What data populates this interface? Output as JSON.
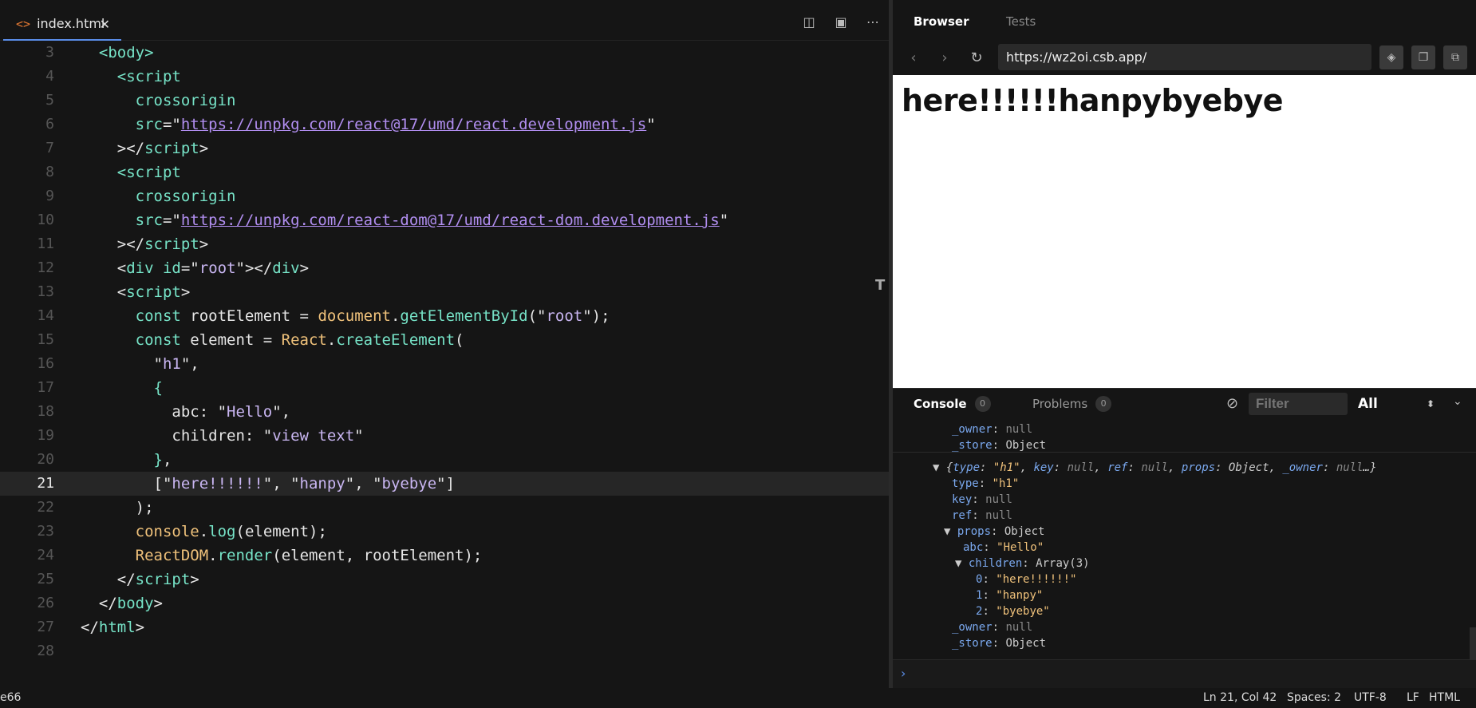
{
  "editor": {
    "tab_label": "index.html",
    "tab_close": "✕",
    "lines": [
      {
        "n": "3",
        "segs": [
          [
            "t-tag",
            "  <body>"
          ]
        ]
      },
      {
        "n": "4",
        "segs": [
          [
            "t-tag",
            "    <script"
          ]
        ]
      },
      {
        "n": "5",
        "segs": [
          [
            "t-attr",
            "      crossorigin"
          ]
        ]
      },
      {
        "n": "6",
        "segs": [
          [
            "t-attr",
            "      src"
          ],
          [
            "t-plain",
            "=\""
          ],
          [
            "t-link",
            "https://unpkg.com/react@17/umd/react.development.js"
          ],
          [
            "t-plain",
            "\""
          ]
        ]
      },
      {
        "n": "7",
        "segs": [
          [
            "t-plain",
            "    ></"
          ],
          [
            "t-tag",
            "script"
          ],
          [
            "t-plain",
            ">"
          ]
        ]
      },
      {
        "n": "8",
        "segs": [
          [
            "t-tag",
            "    <script"
          ]
        ]
      },
      {
        "n": "9",
        "segs": [
          [
            "t-attr",
            "      crossorigin"
          ]
        ]
      },
      {
        "n": "10",
        "segs": [
          [
            "t-attr",
            "      src"
          ],
          [
            "t-plain",
            "=\""
          ],
          [
            "t-link",
            "https://unpkg.com/react-dom@17/umd/react-dom.development.js"
          ],
          [
            "t-plain",
            "\""
          ]
        ]
      },
      {
        "n": "11",
        "segs": [
          [
            "t-plain",
            "    ></"
          ],
          [
            "t-tag",
            "script"
          ],
          [
            "t-plain",
            ">"
          ]
        ]
      },
      {
        "n": "12",
        "segs": [
          [
            "t-plain",
            "    <"
          ],
          [
            "t-tag",
            "div"
          ],
          [
            "t-attr",
            " id"
          ],
          [
            "t-plain",
            "=\""
          ],
          [
            "t-str",
            "root"
          ],
          [
            "t-plain",
            "\"></"
          ],
          [
            "t-tag",
            "div"
          ],
          [
            "t-plain",
            ">"
          ]
        ]
      },
      {
        "n": "13",
        "segs": [
          [
            "t-plain",
            "    <"
          ],
          [
            "t-tag",
            "script"
          ],
          [
            "t-plain",
            ">"
          ]
        ]
      },
      {
        "n": "14",
        "segs": [
          [
            "t-kw",
            "      const "
          ],
          [
            "t-plain",
            "rootElement = "
          ],
          [
            "t-obj",
            "document"
          ],
          [
            "t-plain",
            "."
          ],
          [
            "t-fn",
            "getElementById"
          ],
          [
            "t-plain",
            "(\""
          ],
          [
            "t-str",
            "root"
          ],
          [
            "t-plain",
            "\");"
          ]
        ]
      },
      {
        "n": "15",
        "segs": [
          [
            "t-kw",
            "      const "
          ],
          [
            "t-plain",
            "element = "
          ],
          [
            "t-obj",
            "React"
          ],
          [
            "t-plain",
            "."
          ],
          [
            "t-fn",
            "createElement"
          ],
          [
            "t-plain",
            "("
          ]
        ]
      },
      {
        "n": "16",
        "segs": [
          [
            "t-plain",
            "        \""
          ],
          [
            "t-str",
            "h1"
          ],
          [
            "t-plain",
            "\","
          ]
        ]
      },
      {
        "n": "17",
        "segs": [
          [
            "t-kw",
            "        {"
          ]
        ]
      },
      {
        "n": "18",
        "segs": [
          [
            "t-plain",
            "          abc: \""
          ],
          [
            "t-str",
            "Hello"
          ],
          [
            "t-plain",
            "\","
          ]
        ]
      },
      {
        "n": "19",
        "segs": [
          [
            "t-plain",
            "          children: \""
          ],
          [
            "t-str",
            "view text"
          ],
          [
            "t-plain",
            "\""
          ]
        ]
      },
      {
        "n": "20",
        "segs": [
          [
            "t-kw",
            "        }"
          ],
          [
            "t-plain",
            ","
          ]
        ]
      },
      {
        "n": "21",
        "segs": [
          [
            "t-plain",
            "        [\""
          ],
          [
            "t-str",
            "here!!!!!!"
          ],
          [
            "t-plain",
            "\", \""
          ],
          [
            "t-str",
            "hanpy"
          ],
          [
            "t-plain",
            "\", \""
          ],
          [
            "t-str",
            "byebye"
          ],
          [
            "t-plain",
            "\"]"
          ]
        ]
      },
      {
        "n": "22",
        "segs": [
          [
            "t-plain",
            "      );"
          ]
        ]
      },
      {
        "n": "23",
        "segs": [
          [
            "t-obj",
            "      console"
          ],
          [
            "t-plain",
            "."
          ],
          [
            "t-fn",
            "log"
          ],
          [
            "t-plain",
            "(element);"
          ]
        ]
      },
      {
        "n": "24",
        "segs": [
          [
            "t-obj",
            "      ReactDOM"
          ],
          [
            "t-plain",
            "."
          ],
          [
            "t-fn",
            "render"
          ],
          [
            "t-plain",
            "(element, rootElement);"
          ]
        ]
      },
      {
        "n": "25",
        "segs": [
          [
            "t-plain",
            "    </"
          ],
          [
            "t-tag",
            "script"
          ],
          [
            "t-plain",
            ">"
          ]
        ]
      },
      {
        "n": "26",
        "segs": [
          [
            "t-plain",
            "  </"
          ],
          [
            "t-tag",
            "body"
          ],
          [
            "t-plain",
            ">"
          ]
        ]
      },
      {
        "n": "27",
        "segs": [
          [
            "t-plain",
            "</"
          ],
          [
            "t-tag",
            "html"
          ],
          [
            "t-plain",
            ">"
          ]
        ]
      },
      {
        "n": "28",
        "segs": []
      }
    ],
    "active_line": "21"
  },
  "browser": {
    "tab_browser": "Browser",
    "tab_tests": "Tests",
    "url": "https://wz2oi.csb.app/",
    "heading": "here!!!!!!hanpybyebye"
  },
  "console": {
    "tab_console": "Console",
    "console_count": "0",
    "tab_problems": "Problems",
    "problems_count": "0",
    "filter_placeholder": "Filter",
    "level": "All"
  },
  "status": {
    "left": "e66",
    "position": "Ln 21, Col 42",
    "spaces": "Spaces: 2",
    "encoding": "UTF-8",
    "eol": "LF",
    "language": "HTML"
  },
  "colors": {
    "accent": "#5a8de8",
    "html_icon": "#e37933"
  }
}
